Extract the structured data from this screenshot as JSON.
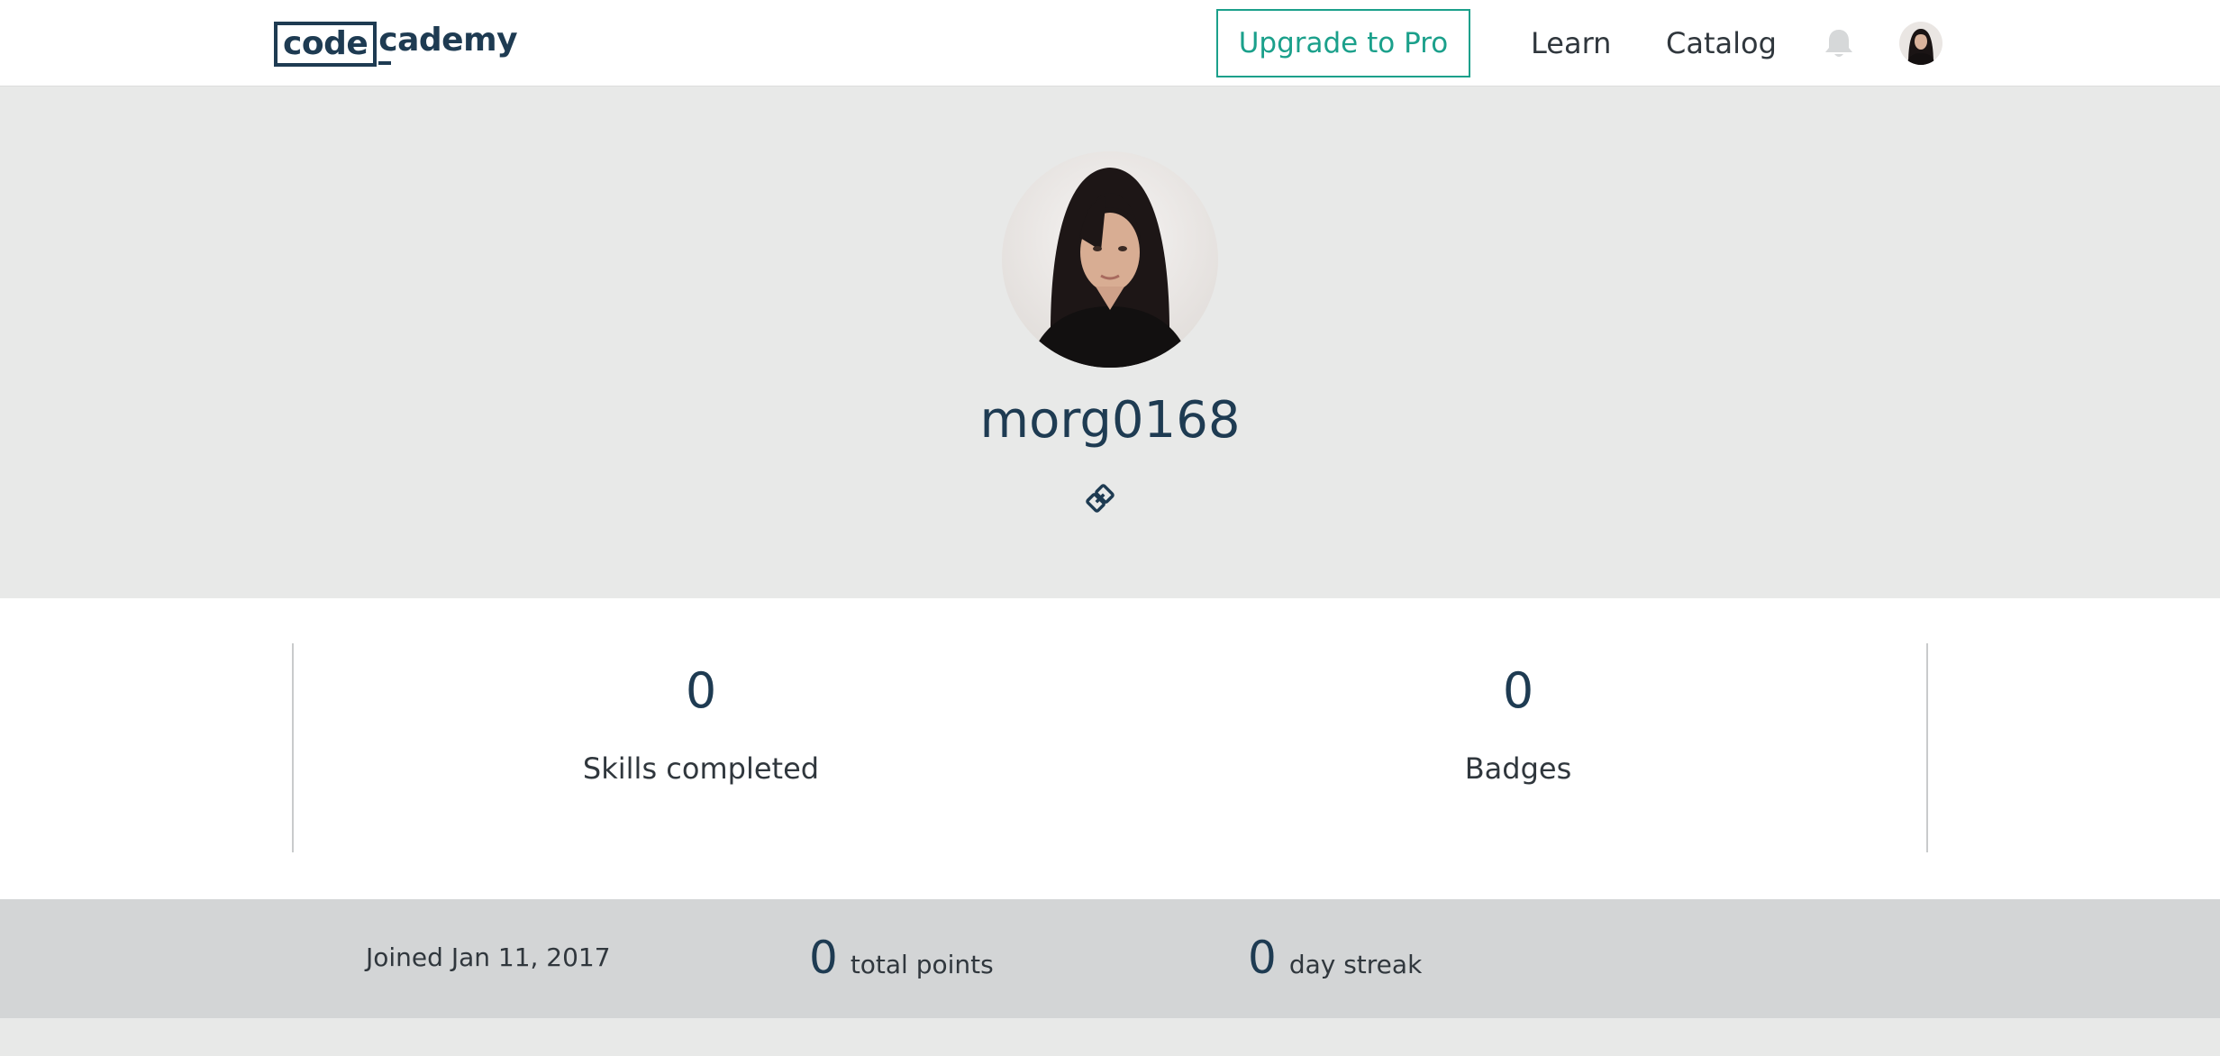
{
  "header": {
    "logo_part1": "code",
    "logo_part2": "cademy",
    "upgrade_label": "Upgrade to Pro",
    "nav": [
      "Learn",
      "Catalog"
    ]
  },
  "profile": {
    "username": "morg0168"
  },
  "stats": [
    {
      "value": "0",
      "label": "Skills completed"
    },
    {
      "value": "0",
      "label": "Badges"
    }
  ],
  "info": {
    "joined": "Joined Jan 11, 2017",
    "total_points_value": "0",
    "total_points_label": "total points",
    "streak_value": "0",
    "streak_label": "day streak"
  },
  "colors": {
    "accent": "#1ba08b",
    "brand_navy": "#1e3b52",
    "header_bg": "#e8e9e8",
    "strip_bg": "#d3d5d6"
  },
  "icons": {
    "notifications": "bell-icon",
    "profile_link": "link-icon"
  }
}
